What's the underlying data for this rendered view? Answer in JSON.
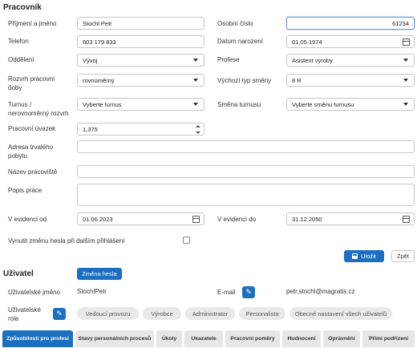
{
  "section_title": "Pracovník",
  "fields": {
    "name": {
      "label": "Příjmení a jméno",
      "value": "Stochl Petr"
    },
    "personal_number": {
      "label": "Osobní číslo",
      "value": "61234"
    },
    "phone": {
      "label": "Telefon",
      "value": "603 179 833"
    },
    "birth_date": {
      "label": "Datum narození",
      "value": "01.05.1974"
    },
    "department": {
      "label": "Oddělení",
      "value": "Vývoj"
    },
    "profession": {
      "label": "Profese",
      "value": "Asistent výroby"
    },
    "work_schedule": {
      "label_line1": "Rozvrh pracovní",
      "label_line2": "doby",
      "value": "rovnoměrný"
    },
    "default_shift_type": {
      "label": "Výchozí typ směny",
      "value": "8 R"
    },
    "turnus": {
      "label_line1": "Turnus /",
      "label_line2": "nerovnoměrný rozvrh",
      "value": "Vyberte turnus"
    },
    "turnus_shift": {
      "label": "Směna turnusu",
      "value": "Vyberte směnu turnusu"
    },
    "workload": {
      "label": "Pracovní úvazek",
      "value": "1,375"
    },
    "address": {
      "label_line1": "Adresa trvalého",
      "label_line2": "pobytu",
      "value": ""
    },
    "workplace": {
      "label": "Název pracoviště",
      "value": ""
    },
    "job_description": {
      "label": "Popis práce",
      "value": ""
    },
    "record_from": {
      "label": "V evidenci od",
      "value": "01.06.2023"
    },
    "record_to": {
      "label": "V evidenci do",
      "value": "31.12.2050"
    },
    "force_password_change": {
      "label": "Vynutit změnu hesla při dalším přihlášení",
      "checked": false
    }
  },
  "actions": {
    "save": "Uložit",
    "back": "Zpět"
  },
  "user": {
    "title": "Uživatel",
    "change_password": "Změna hesla",
    "username_label": "Uživatelské jméno",
    "username": "StochlPetr",
    "email_label": "E-mail",
    "email": "petr.stochl@magratis.cz",
    "role_label_line1": "Uživatelské",
    "role_label_line2": "role",
    "roles": [
      "Vedoucí provozu",
      "Výrobce",
      "Administrator",
      "Personalista",
      "Obecné nastavení všech uživatelů"
    ]
  },
  "tabs": [
    {
      "label": "Způsobilosti pro profesi",
      "active": true
    },
    {
      "label": "Stavy personálních procesů",
      "active": false
    },
    {
      "label": "Úkoly",
      "active": false
    },
    {
      "label": "Ukazatele",
      "active": false
    },
    {
      "label": "Pracovní poměry",
      "active": false
    },
    {
      "label": "Hodnocení",
      "active": false
    },
    {
      "label": "Oprávnění",
      "active": false
    },
    {
      "label": "Přímí podřízení",
      "active": false
    }
  ],
  "colors": {
    "accent": "#1c6fbf",
    "chip_bg": "#e9e9e9",
    "tab_bg": "#e6e6e6"
  }
}
